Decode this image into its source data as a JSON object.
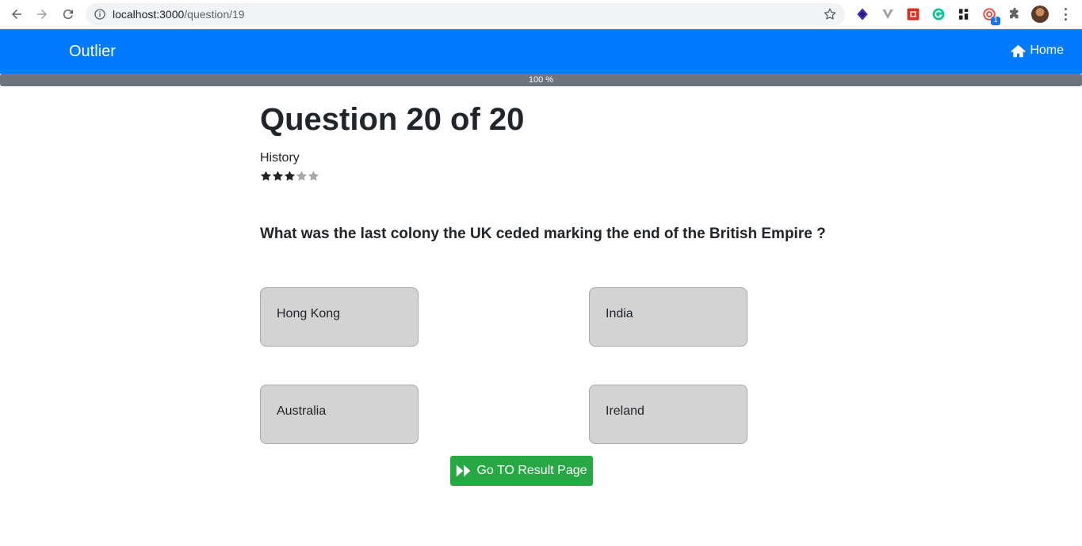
{
  "browser": {
    "url_host": "localhost:3000",
    "url_path": "/question/19",
    "extension_badge": "1"
  },
  "navbar": {
    "brand": "Outlier",
    "home_label": "Home",
    "color": "#007bff"
  },
  "progress": {
    "percent": 100,
    "label": "100 %"
  },
  "question": {
    "title": "Question 20 of 20",
    "category": "History",
    "difficulty_stars": 3,
    "max_stars": 5,
    "text": "What was the last colony the UK ceded marking the end of the British Empire ?",
    "answers": [
      {
        "label": "Hong Kong"
      },
      {
        "label": "India"
      },
      {
        "label": "Australia"
      },
      {
        "label": "Ireland"
      }
    ]
  },
  "actions": {
    "result_button_label": "Go TO Result Page",
    "result_button_color": "#28a745"
  }
}
